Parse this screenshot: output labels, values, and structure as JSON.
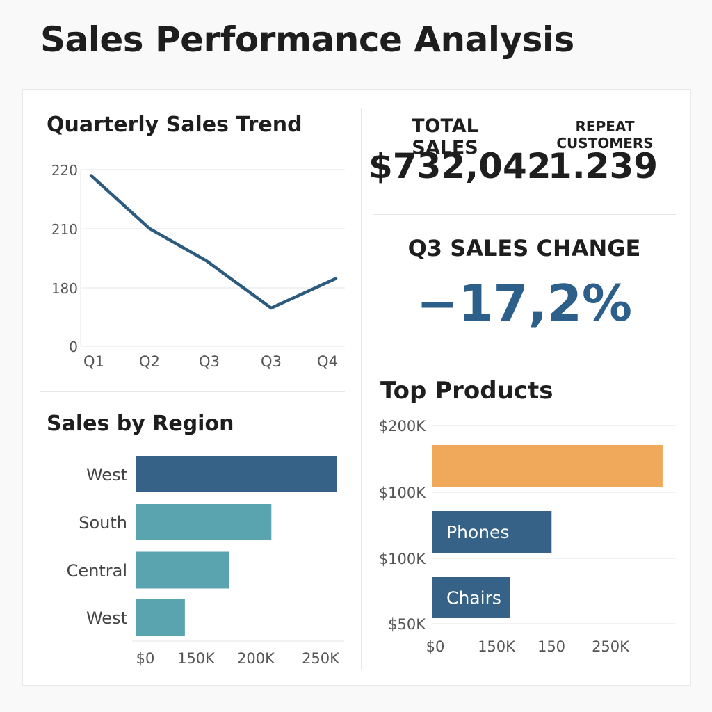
{
  "page": {
    "title": "Sales Performance Analysis"
  },
  "kpis": {
    "total_sales": {
      "label": "TOTAL SALES",
      "value": "$732,042"
    },
    "repeat_customers": {
      "label": "REPEAT CUSTOMERS",
      "value": "1.239"
    },
    "q3_change": {
      "label": "Q3 SALES CHANGE",
      "value": "−17,2%",
      "color": "#2c5f8a"
    }
  },
  "chart_data": [
    {
      "type": "line",
      "title": "Quarterly Sales Trend",
      "categories": [
        "Q1",
        "Q2",
        "Q3",
        "Q3",
        "Q4"
      ],
      "y_tick_labels": [
        "220",
        "210",
        "180",
        "0"
      ],
      "values": [
        219,
        210,
        204.5,
        196.5,
        201.5
      ],
      "ylim": [
        190,
        220
      ],
      "grid": true,
      "color": "#2c5b80"
    },
    {
      "type": "bar",
      "orientation": "horizontal",
      "title": "Sales by Region",
      "categories": [
        "West",
        "South",
        "Central",
        "West"
      ],
      "values": [
        265000,
        179000,
        123000,
        65000
      ],
      "x_tick_labels": [
        "$0",
        "150K",
        "200K",
        "250K"
      ],
      "xlim": [
        0,
        275000
      ],
      "colors": [
        "#356286",
        "#5aa4b0",
        "#5aa4b0",
        "#5aa4b0"
      ],
      "grid": true
    },
    {
      "type": "bar",
      "orientation": "horizontal",
      "title": "Top Products",
      "categories": [
        "",
        "Phones",
        "Chairs"
      ],
      "values": [
        312000,
        162000,
        106000
      ],
      "y_tick_labels": [
        "$200K",
        "$100K",
        "$100K",
        "$50K"
      ],
      "x_tick_labels": [
        "$0",
        "150K",
        "150",
        "250K"
      ],
      "xlim": [
        0,
        330000
      ],
      "colors": [
        "#f0a95a",
        "#356286",
        "#356286"
      ],
      "grid": true
    }
  ]
}
